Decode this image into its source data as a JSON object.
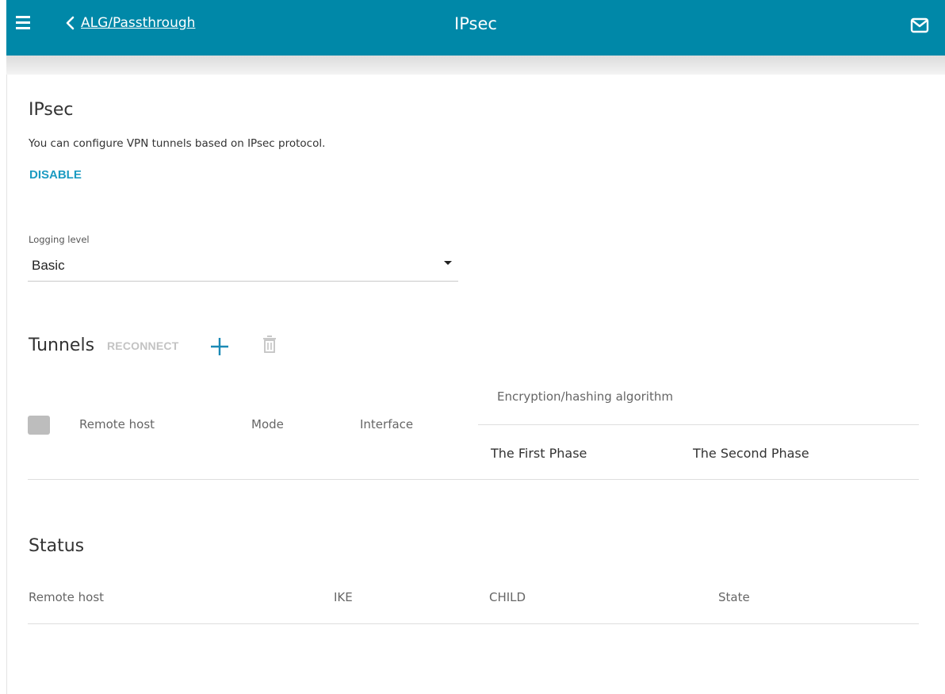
{
  "header": {
    "back_label": "ALG/Passthrough",
    "title": "IPsec",
    "icons": [
      "menu-icon",
      "chevron-left-icon",
      "mail-icon"
    ]
  },
  "ipsec": {
    "title": "IPsec",
    "description": "You can configure VPN tunnels based on IPsec protocol.",
    "disable_label": "DISABLE",
    "logging_label": "Logging level",
    "logging_value": "Basic"
  },
  "tunnels": {
    "title": "Tunnels",
    "reconnect_label": "RECONNECT",
    "columns": {
      "remote_host": "Remote host",
      "mode": "Mode",
      "interface": "Interface",
      "encryption": "Encryption/hashing algorithm",
      "first_phase": "The First Phase",
      "second_phase": "The Second Phase"
    },
    "rows": []
  },
  "status": {
    "title": "Status",
    "columns": {
      "remote_host": "Remote host",
      "ike": "IKE",
      "child": "CHILD",
      "state": "State"
    },
    "rows": []
  },
  "colors": {
    "header_bg": "#0088a8",
    "accent": "#1b9bc2",
    "disabled": "#c3c3c3"
  }
}
